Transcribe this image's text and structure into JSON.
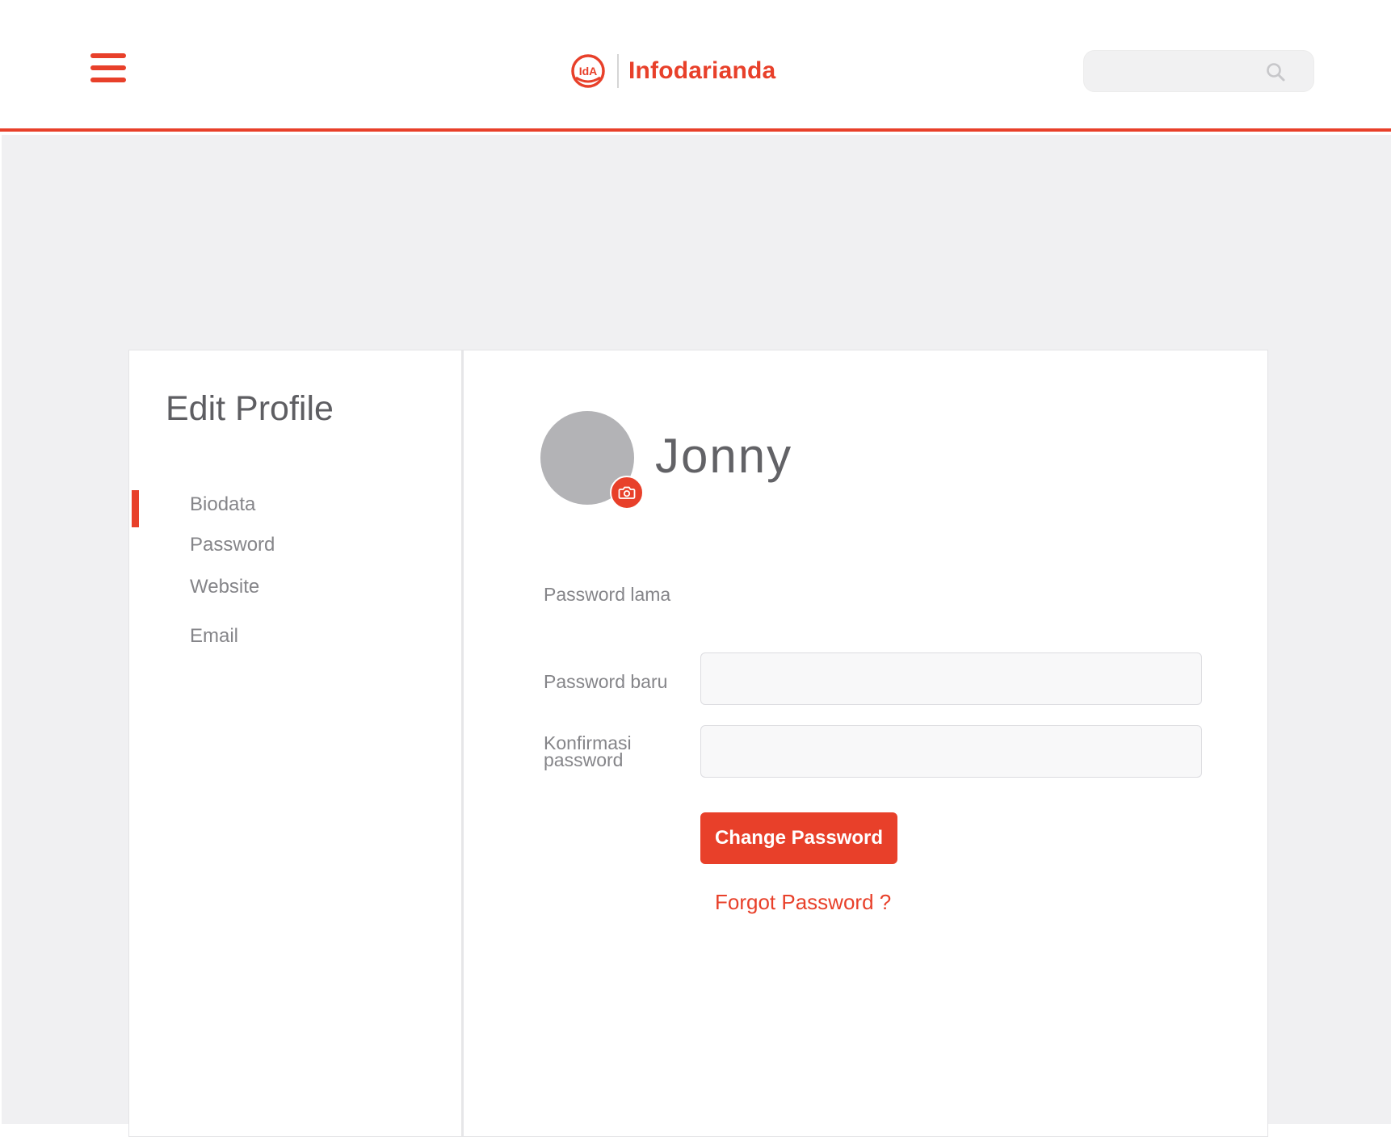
{
  "header": {
    "brand_name": "Infodarianda",
    "logo_monogram": "IdA",
    "search": {
      "placeholder": "",
      "value": ""
    },
    "accent_color": "#e8402a"
  },
  "sidebar": {
    "title": "Edit Profile",
    "items": [
      {
        "label": "Biodata",
        "active": true
      },
      {
        "label": "Password",
        "active": false
      },
      {
        "label": "Website",
        "active": false
      },
      {
        "label": "Email",
        "active": false
      }
    ]
  },
  "profile": {
    "name": "Jonny",
    "avatar_icon": "camera-icon"
  },
  "password_form": {
    "old_password_label": "Password lama",
    "new_password_label": "Password baru",
    "confirm_password_label_line1": "Konfirmasi",
    "confirm_password_label_line2": "password",
    "new_password_value": "",
    "confirm_password_value": "",
    "submit_label": "Change Password",
    "forgot_label": "Forgot Password ?"
  }
}
